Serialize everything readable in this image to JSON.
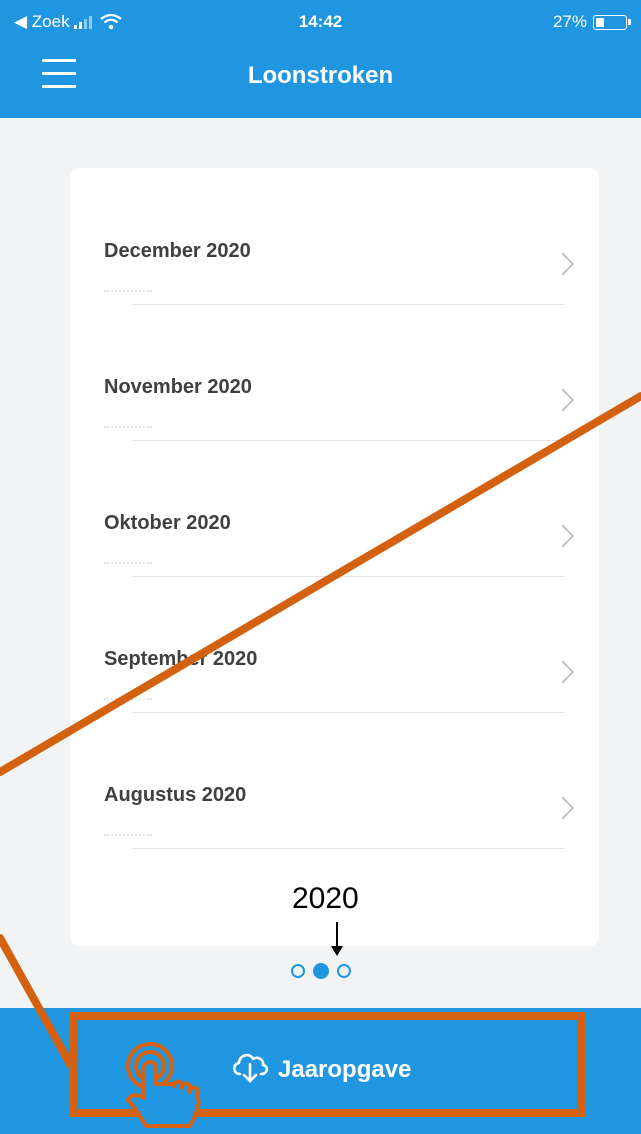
{
  "status_bar": {
    "back_label": "◀ Zoek",
    "time": "14:42",
    "battery": "27%"
  },
  "header": {
    "title": "Loonstroken"
  },
  "payslips": [
    {
      "label": "December 2020"
    },
    {
      "label": "November 2020"
    },
    {
      "label": "Oktober 2020"
    },
    {
      "label": "September 2020"
    },
    {
      "label": "Augustus 2020"
    }
  ],
  "pager": {
    "pages": 3,
    "active_index": 1
  },
  "annotation": {
    "year": "2020",
    "accent_color": "#d4610f"
  },
  "footer": {
    "button_label": "Jaaropgave"
  },
  "colors": {
    "brand": "#2196e0",
    "background": "#f2f3f5",
    "card": "#ffffff"
  },
  "icons": {
    "menu": "hamburger-menu-icon",
    "chevron": "chevron-right-icon",
    "cloud": "cloud-download-icon",
    "hand": "tap-hand-icon"
  }
}
